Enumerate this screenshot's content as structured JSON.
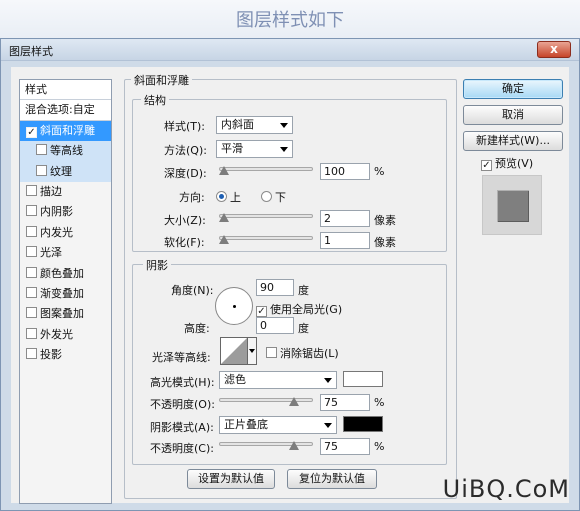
{
  "banner": {
    "text": "图层样式如下"
  },
  "dialog": {
    "title": "图层样式",
    "close_label": "x"
  },
  "style_list": {
    "header": "样式",
    "blend_options": "混合选项:自定",
    "items": [
      {
        "label": "斜面和浮雕",
        "checked": true,
        "selected": true
      },
      {
        "label": "等高线",
        "checked": false,
        "sub": true
      },
      {
        "label": "纹理",
        "checked": false,
        "sub": true
      },
      {
        "label": "描边",
        "checked": false
      },
      {
        "label": "内阴影",
        "checked": false
      },
      {
        "label": "内发光",
        "checked": false
      },
      {
        "label": "光泽",
        "checked": false
      },
      {
        "label": "颜色叠加",
        "checked": false
      },
      {
        "label": "渐变叠加",
        "checked": false
      },
      {
        "label": "图案叠加",
        "checked": false
      },
      {
        "label": "外发光",
        "checked": false
      },
      {
        "label": "投影",
        "checked": false
      }
    ]
  },
  "bevel": {
    "group_title": "斜面和浮雕",
    "structure_title": "结构",
    "style_label": "样式(T):",
    "style_value": "内斜面",
    "method_label": "方法(Q):",
    "method_value": "平滑",
    "depth_label": "深度(D):",
    "depth_value": "100",
    "depth_unit": "%",
    "direction_label": "方向:",
    "direction_up": "上",
    "direction_down": "下",
    "size_label": "大小(Z):",
    "size_value": "2",
    "size_unit": "像素",
    "soften_label": "软化(F):",
    "soften_value": "1",
    "soften_unit": "像素"
  },
  "shading": {
    "title": "阴影",
    "angle_label": "角度(N):",
    "angle_value": "90",
    "angle_unit": "度",
    "global_light_label": "使用全局光(G)",
    "altitude_label": "高度:",
    "altitude_value": "0",
    "altitude_unit": "度",
    "gloss_label": "光泽等高线:",
    "antialias_label": "消除锯齿(L)",
    "highlight_mode_label": "高光模式(H):",
    "highlight_mode_value": "滤色",
    "highlight_color": "#ffffff",
    "highlight_opacity_label": "不透明度(O):",
    "highlight_opacity_value": "75",
    "opacity_unit": "%",
    "shadow_mode_label": "阴影模式(A):",
    "shadow_mode_value": "正片叠底",
    "shadow_color": "#000000",
    "shadow_opacity_label": "不透明度(C):",
    "shadow_opacity_value": "75"
  },
  "footer": {
    "set_default": "设置为默认值",
    "reset_default": "复位为默认值"
  },
  "right_panel": {
    "ok": "确定",
    "cancel": "取消",
    "new_style": "新建样式(W)...",
    "preview_label": "预览(V)"
  },
  "watermark": "UiBQ.CoM"
}
